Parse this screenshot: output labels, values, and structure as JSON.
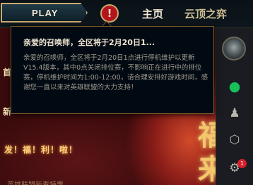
{
  "top_bar": {
    "play_label": "PLAY",
    "alert_symbol": "!",
    "nav": [
      "主页",
      "云顶之弈"
    ]
  },
  "announcement": {
    "title": "亲爱的召唤师，全区将于2月20日1...",
    "body": "亲爱的召唤师，全区将于2月20日1点进行停机维护以更新V15.4版本，其中0点关闭排位赛，不影响正在进行中的排位赛，停机维护时间为1:00-12:00，请合理安排好游戏时间，感谢您一直以来对英雄联盟的大力支持！"
  },
  "background": {
    "slogan": "发！福！利！啦！",
    "fu_char_1": "福",
    "fu_char_2": "来",
    "left_glyph_1": "首",
    "left_glyph_2": "新",
    "bottom_text": "英雄联盟新春特惠"
  },
  "sidebar": {
    "icons": [
      "avatar",
      "chat-icon",
      "friends-icon",
      "cube-icon",
      "settings-icon"
    ],
    "notification_count": "1"
  },
  "colors": {
    "gold": "#c8aa6e",
    "alert_red": "#b4141e",
    "chat_green": "#18c05a",
    "badge_red": "#d51f2a"
  }
}
